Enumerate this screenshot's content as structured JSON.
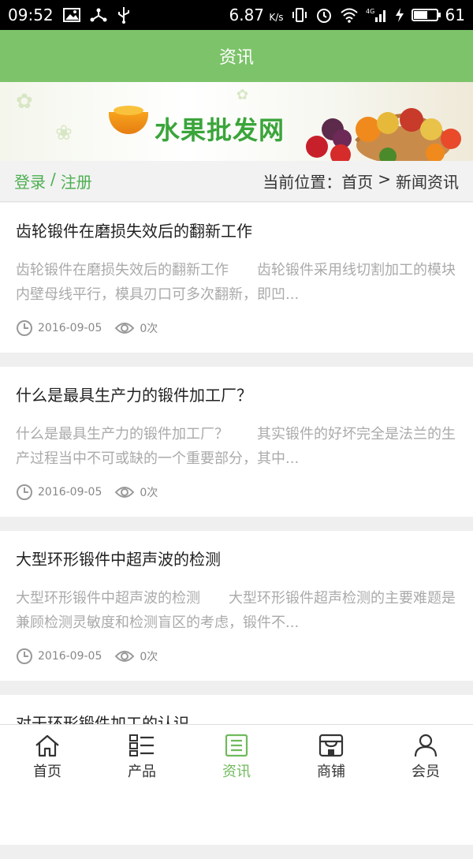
{
  "status_bar": {
    "time": "09:52",
    "speed": "6.87",
    "speed_unit": "K/s",
    "network": "4G",
    "battery": "61",
    "battery_level": 0.61
  },
  "header": {
    "title": "资讯"
  },
  "banner": {
    "site_title": "水果批发网"
  },
  "location_bar": {
    "login": "登录",
    "separator": "/",
    "register": "注册",
    "location_label": "当前位置：",
    "home": "首页",
    "arrow": ">",
    "current": "新闻资讯"
  },
  "articles": [
    {
      "title": "齿轮锻件在磨损失效后的翻新工作",
      "summary": "齿轮锻件在磨损失效后的翻新工作　　齿轮锻件采用线切割加工的模块内壁母线平行，模具刃口可多次翻新，即凹...",
      "date": "2016-09-05",
      "views": "0次"
    },
    {
      "title": "什么是最具生产力的锻件加工厂？",
      "summary": "什么是最具生产力的锻件加工厂？　　其实锻件的好坏完全是法兰的生产过程当中不可或缺的一个重要部分，其中...",
      "date": "2016-09-05",
      "views": "0次"
    },
    {
      "title": "大型环形锻件中超声波的检测",
      "summary": "大型环形锻件中超声波的检测　　大型环形锻件超声检测的主要难题是兼顾检测灵敏度和检测盲区的考虑，锻件不...",
      "date": "2016-09-05",
      "views": "0次"
    },
    {
      "title": "对于环形锻件加工的认识",
      "summary": "",
      "date": "",
      "views": ""
    }
  ],
  "tabbar": {
    "items": [
      {
        "label": "首页",
        "icon": "home-icon"
      },
      {
        "label": "产品",
        "icon": "list-icon"
      },
      {
        "label": "资讯",
        "icon": "news-icon",
        "active": true
      },
      {
        "label": "商铺",
        "icon": "shop-icon"
      },
      {
        "label": "会员",
        "icon": "user-icon"
      }
    ]
  },
  "colors": {
    "accent": "#7cc36a",
    "link": "#4caf50",
    "active_tab": "#6fba5b"
  }
}
